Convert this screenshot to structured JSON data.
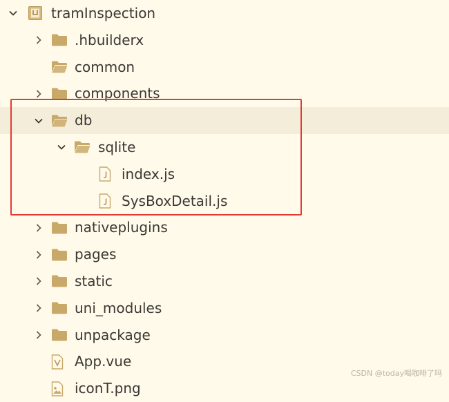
{
  "explorer": {
    "root": {
      "label": "tramInspection",
      "expanded": true,
      "icon": "project-icon"
    },
    "items": [
      {
        "label": ".hbuilderx",
        "type": "folder",
        "expanded": false,
        "level": 1
      },
      {
        "label": "common",
        "type": "folder-open",
        "expanded": null,
        "level": 1
      },
      {
        "label": "components",
        "type": "folder",
        "expanded": false,
        "level": 1
      },
      {
        "label": "db",
        "type": "folder-open",
        "expanded": true,
        "level": 1,
        "selected": true
      },
      {
        "label": "sqlite",
        "type": "folder-open",
        "expanded": true,
        "level": 2
      },
      {
        "label": "index.js",
        "type": "js-file",
        "level": 3
      },
      {
        "label": "SysBoxDetail.js",
        "type": "js-file",
        "level": 3
      },
      {
        "label": "nativeplugins",
        "type": "folder",
        "expanded": false,
        "level": 1
      },
      {
        "label": "pages",
        "type": "folder",
        "expanded": false,
        "level": 1
      },
      {
        "label": "static",
        "type": "folder",
        "expanded": false,
        "level": 1
      },
      {
        "label": "uni_modules",
        "type": "folder",
        "expanded": false,
        "level": 1
      },
      {
        "label": "unpackage",
        "type": "folder",
        "expanded": false,
        "level": 1
      },
      {
        "label": "App.vue",
        "type": "vue-file",
        "level": 1
      },
      {
        "label": "iconT.png",
        "type": "image-file",
        "level": 1
      }
    ]
  },
  "watermark": "CSDN @today喝咖啡了吗",
  "colors": {
    "background": "#fffaea",
    "selected_row": "#f3edd9",
    "folder": "#c9a96a",
    "annotation_box": "#e53935"
  }
}
